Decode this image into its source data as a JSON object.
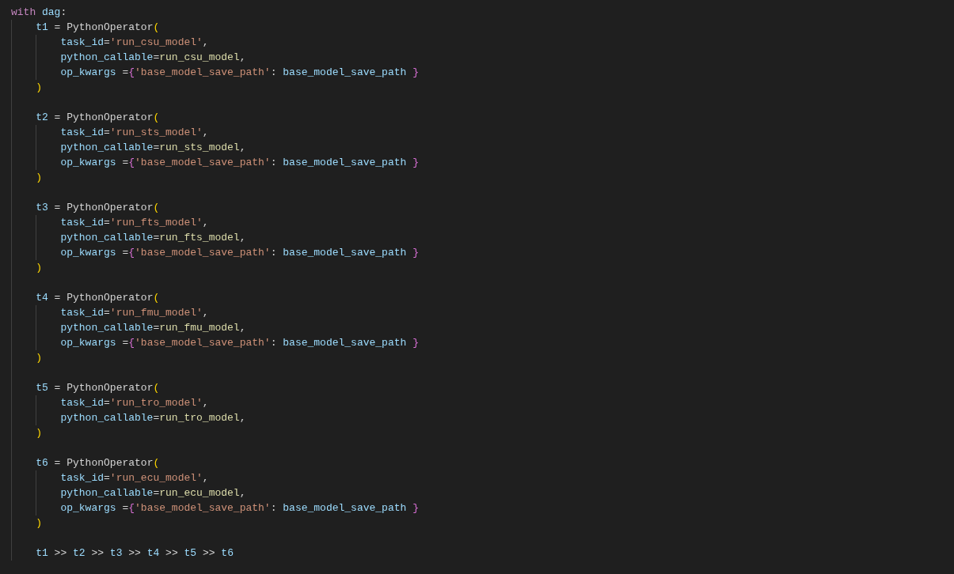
{
  "editor": {
    "lines": [
      {
        "kind": "code",
        "tokens": [
          {
            "kind": "keyword",
            "text": "with "
          },
          {
            "kind": "variable",
            "text": "dag"
          },
          {
            "kind": "plain",
            "text": ":"
          }
        ],
        "children": [
          {
            "kind": "code",
            "tokens": [
              {
                "kind": "variable",
                "text": "t1"
              },
              {
                "kind": "plain",
                "text": " = PythonOperator"
              },
              {
                "kind": "paren",
                "text": "("
              }
            ],
            "children": [
              {
                "kind": "code",
                "tokens": [
                  {
                    "kind": "variable",
                    "text": "task_id"
                  },
                  {
                    "kind": "plain",
                    "text": "="
                  },
                  {
                    "kind": "string",
                    "text": "'run_csu_model'"
                  },
                  {
                    "kind": "plain",
                    "text": ","
                  }
                ]
              },
              {
                "kind": "code",
                "tokens": [
                  {
                    "kind": "variable",
                    "text": "python_callable"
                  },
                  {
                    "kind": "plain",
                    "text": "="
                  },
                  {
                    "kind": "function",
                    "text": "run_csu_model"
                  },
                  {
                    "kind": "plain",
                    "text": ","
                  }
                ]
              },
              {
                "kind": "code",
                "tokens": [
                  {
                    "kind": "variable",
                    "text": "op_kwargs"
                  },
                  {
                    "kind": "plain",
                    "text": " ="
                  },
                  {
                    "kind": "brace",
                    "text": "{"
                  },
                  {
                    "kind": "string",
                    "text": "'base_model_save_path'"
                  },
                  {
                    "kind": "plain",
                    "text": ": "
                  },
                  {
                    "kind": "variable",
                    "text": "base_model_save_path"
                  },
                  {
                    "kind": "brace",
                    "text": " }"
                  }
                ]
              }
            ]
          },
          {
            "kind": "code",
            "tokens": [
              {
                "kind": "paren",
                "text": ")"
              }
            ]
          },
          {
            "kind": "blank"
          },
          {
            "kind": "code",
            "tokens": [
              {
                "kind": "variable",
                "text": "t2"
              },
              {
                "kind": "plain",
                "text": " = PythonOperator"
              },
              {
                "kind": "paren",
                "text": "("
              }
            ],
            "children": [
              {
                "kind": "code",
                "tokens": [
                  {
                    "kind": "variable",
                    "text": "task_id"
                  },
                  {
                    "kind": "plain",
                    "text": "="
                  },
                  {
                    "kind": "string",
                    "text": "'run_sts_model'"
                  },
                  {
                    "kind": "plain",
                    "text": ","
                  }
                ]
              },
              {
                "kind": "code",
                "tokens": [
                  {
                    "kind": "variable",
                    "text": "python_callable"
                  },
                  {
                    "kind": "plain",
                    "text": "="
                  },
                  {
                    "kind": "function",
                    "text": "run_sts_model"
                  },
                  {
                    "kind": "plain",
                    "text": ","
                  }
                ]
              },
              {
                "kind": "code",
                "tokens": [
                  {
                    "kind": "variable",
                    "text": "op_kwargs"
                  },
                  {
                    "kind": "plain",
                    "text": " ="
                  },
                  {
                    "kind": "brace",
                    "text": "{"
                  },
                  {
                    "kind": "string",
                    "text": "'base_model_save_path'"
                  },
                  {
                    "kind": "plain",
                    "text": ": "
                  },
                  {
                    "kind": "variable",
                    "text": "base_model_save_path"
                  },
                  {
                    "kind": "brace",
                    "text": " }"
                  }
                ]
              }
            ]
          },
          {
            "kind": "code",
            "tokens": [
              {
                "kind": "paren",
                "text": ")"
              }
            ]
          },
          {
            "kind": "blank"
          },
          {
            "kind": "code",
            "tokens": [
              {
                "kind": "variable",
                "text": "t3"
              },
              {
                "kind": "plain",
                "text": " = PythonOperator"
              },
              {
                "kind": "paren",
                "text": "("
              }
            ],
            "children": [
              {
                "kind": "code",
                "tokens": [
                  {
                    "kind": "variable",
                    "text": "task_id"
                  },
                  {
                    "kind": "plain",
                    "text": "="
                  },
                  {
                    "kind": "string",
                    "text": "'run_fts_model'"
                  },
                  {
                    "kind": "plain",
                    "text": ","
                  }
                ]
              },
              {
                "kind": "code",
                "tokens": [
                  {
                    "kind": "variable",
                    "text": "python_callable"
                  },
                  {
                    "kind": "plain",
                    "text": "="
                  },
                  {
                    "kind": "function",
                    "text": "run_fts_model"
                  },
                  {
                    "kind": "plain",
                    "text": ","
                  }
                ]
              },
              {
                "kind": "code",
                "tokens": [
                  {
                    "kind": "variable",
                    "text": "op_kwargs"
                  },
                  {
                    "kind": "plain",
                    "text": " ="
                  },
                  {
                    "kind": "brace",
                    "text": "{"
                  },
                  {
                    "kind": "string",
                    "text": "'base_model_save_path'"
                  },
                  {
                    "kind": "plain",
                    "text": ": "
                  },
                  {
                    "kind": "variable",
                    "text": "base_model_save_path"
                  },
                  {
                    "kind": "brace",
                    "text": " }"
                  }
                ]
              }
            ]
          },
          {
            "kind": "code",
            "tokens": [
              {
                "kind": "paren",
                "text": ")"
              }
            ]
          },
          {
            "kind": "blank"
          },
          {
            "kind": "code",
            "tokens": [
              {
                "kind": "variable",
                "text": "t4"
              },
              {
                "kind": "plain",
                "text": " = PythonOperator"
              },
              {
                "kind": "paren",
                "text": "("
              }
            ],
            "children": [
              {
                "kind": "code",
                "tokens": [
                  {
                    "kind": "variable",
                    "text": "task_id"
                  },
                  {
                    "kind": "plain",
                    "text": "="
                  },
                  {
                    "kind": "string",
                    "text": "'run_fmu_model'"
                  },
                  {
                    "kind": "plain",
                    "text": ","
                  }
                ]
              },
              {
                "kind": "code",
                "tokens": [
                  {
                    "kind": "variable",
                    "text": "python_callable"
                  },
                  {
                    "kind": "plain",
                    "text": "="
                  },
                  {
                    "kind": "function",
                    "text": "run_fmu_model"
                  },
                  {
                    "kind": "plain",
                    "text": ","
                  }
                ]
              },
              {
                "kind": "code",
                "tokens": [
                  {
                    "kind": "variable",
                    "text": "op_kwargs"
                  },
                  {
                    "kind": "plain",
                    "text": " ="
                  },
                  {
                    "kind": "brace",
                    "text": "{"
                  },
                  {
                    "kind": "string",
                    "text": "'base_model_save_path'"
                  },
                  {
                    "kind": "plain",
                    "text": ": "
                  },
                  {
                    "kind": "variable",
                    "text": "base_model_save_path"
                  },
                  {
                    "kind": "brace",
                    "text": " }"
                  }
                ]
              }
            ]
          },
          {
            "kind": "code",
            "tokens": [
              {
                "kind": "paren",
                "text": ")"
              }
            ]
          },
          {
            "kind": "blank"
          },
          {
            "kind": "code",
            "tokens": [
              {
                "kind": "variable",
                "text": "t5"
              },
              {
                "kind": "plain",
                "text": " = PythonOperator"
              },
              {
                "kind": "paren",
                "text": "("
              }
            ],
            "children": [
              {
                "kind": "code",
                "tokens": [
                  {
                    "kind": "variable",
                    "text": "task_id"
                  },
                  {
                    "kind": "plain",
                    "text": "="
                  },
                  {
                    "kind": "string",
                    "text": "'run_tro_model'"
                  },
                  {
                    "kind": "plain",
                    "text": ","
                  }
                ]
              },
              {
                "kind": "code",
                "tokens": [
                  {
                    "kind": "variable",
                    "text": "python_callable"
                  },
                  {
                    "kind": "plain",
                    "text": "="
                  },
                  {
                    "kind": "function",
                    "text": "run_tro_model"
                  },
                  {
                    "kind": "plain",
                    "text": ","
                  }
                ]
              }
            ]
          },
          {
            "kind": "code",
            "tokens": [
              {
                "kind": "paren",
                "text": ")"
              }
            ]
          },
          {
            "kind": "blank"
          },
          {
            "kind": "code",
            "tokens": [
              {
                "kind": "variable",
                "text": "t6"
              },
              {
                "kind": "plain",
                "text": " = PythonOperator"
              },
              {
                "kind": "paren",
                "text": "("
              }
            ],
            "children": [
              {
                "kind": "code",
                "tokens": [
                  {
                    "kind": "variable",
                    "text": "task_id"
                  },
                  {
                    "kind": "plain",
                    "text": "="
                  },
                  {
                    "kind": "string",
                    "text": "'run_ecu_model'"
                  },
                  {
                    "kind": "plain",
                    "text": ","
                  }
                ]
              },
              {
                "kind": "code",
                "tokens": [
                  {
                    "kind": "variable",
                    "text": "python_callable"
                  },
                  {
                    "kind": "plain",
                    "text": "="
                  },
                  {
                    "kind": "function",
                    "text": "run_ecu_model"
                  },
                  {
                    "kind": "plain",
                    "text": ","
                  }
                ]
              },
              {
                "kind": "code",
                "tokens": [
                  {
                    "kind": "variable",
                    "text": "op_kwargs"
                  },
                  {
                    "kind": "plain",
                    "text": " ="
                  },
                  {
                    "kind": "brace",
                    "text": "{"
                  },
                  {
                    "kind": "string",
                    "text": "'base_model_save_path'"
                  },
                  {
                    "kind": "plain",
                    "text": ": "
                  },
                  {
                    "kind": "variable",
                    "text": "base_model_save_path"
                  },
                  {
                    "kind": "brace",
                    "text": " }"
                  }
                ]
              }
            ]
          },
          {
            "kind": "code",
            "tokens": [
              {
                "kind": "paren",
                "text": ")"
              }
            ]
          },
          {
            "kind": "blank"
          },
          {
            "kind": "code",
            "tokens": [
              {
                "kind": "variable",
                "text": "t1"
              },
              {
                "kind": "plain",
                "text": " >> "
              },
              {
                "kind": "variable",
                "text": "t2"
              },
              {
                "kind": "plain",
                "text": " >> "
              },
              {
                "kind": "variable",
                "text": "t3"
              },
              {
                "kind": "plain",
                "text": " >> "
              },
              {
                "kind": "variable",
                "text": "t4"
              },
              {
                "kind": "plain",
                "text": " >> "
              },
              {
                "kind": "variable",
                "text": "t5"
              },
              {
                "kind": "plain",
                "text": " >> "
              },
              {
                "kind": "variable",
                "text": "t6"
              }
            ]
          }
        ]
      }
    ]
  }
}
